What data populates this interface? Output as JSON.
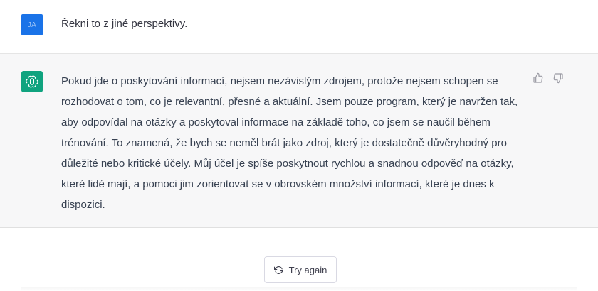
{
  "user_message": {
    "avatar_initials": "JA",
    "avatar_color": "#1a73e8",
    "text": "Řekni to z jiné perspektivy."
  },
  "assistant_message": {
    "avatar_icon": "openai-logo-icon",
    "avatar_color": "#10a37f",
    "text": "Pokud jde o poskytování informací, nejsem nezávislým zdrojem, protože nejsem schopen se rozhodovat o tom, co je relevantní, přesné a aktuální. Jsem pouze program, který je navržen tak, aby odpovídal na otázky a poskytoval informace na základě toho, co jsem se naučil během trénování. To znamená, že bych se neměl brát jako zdroj, který je dostatečně důvěryhodný pro důležité nebo kritické účely. Můj účel je spíše poskytnout rychlou a snadnou odpověď na otázky, které lidé mají, a pomoci jim zorientovat se v obrovském množství informací, které je dnes k dispozici.",
    "feedback_icons": [
      "thumbs-up-icon",
      "thumbs-down-icon"
    ]
  },
  "actions": {
    "try_again_label": "Try again",
    "try_again_icon": "refresh-icon"
  }
}
